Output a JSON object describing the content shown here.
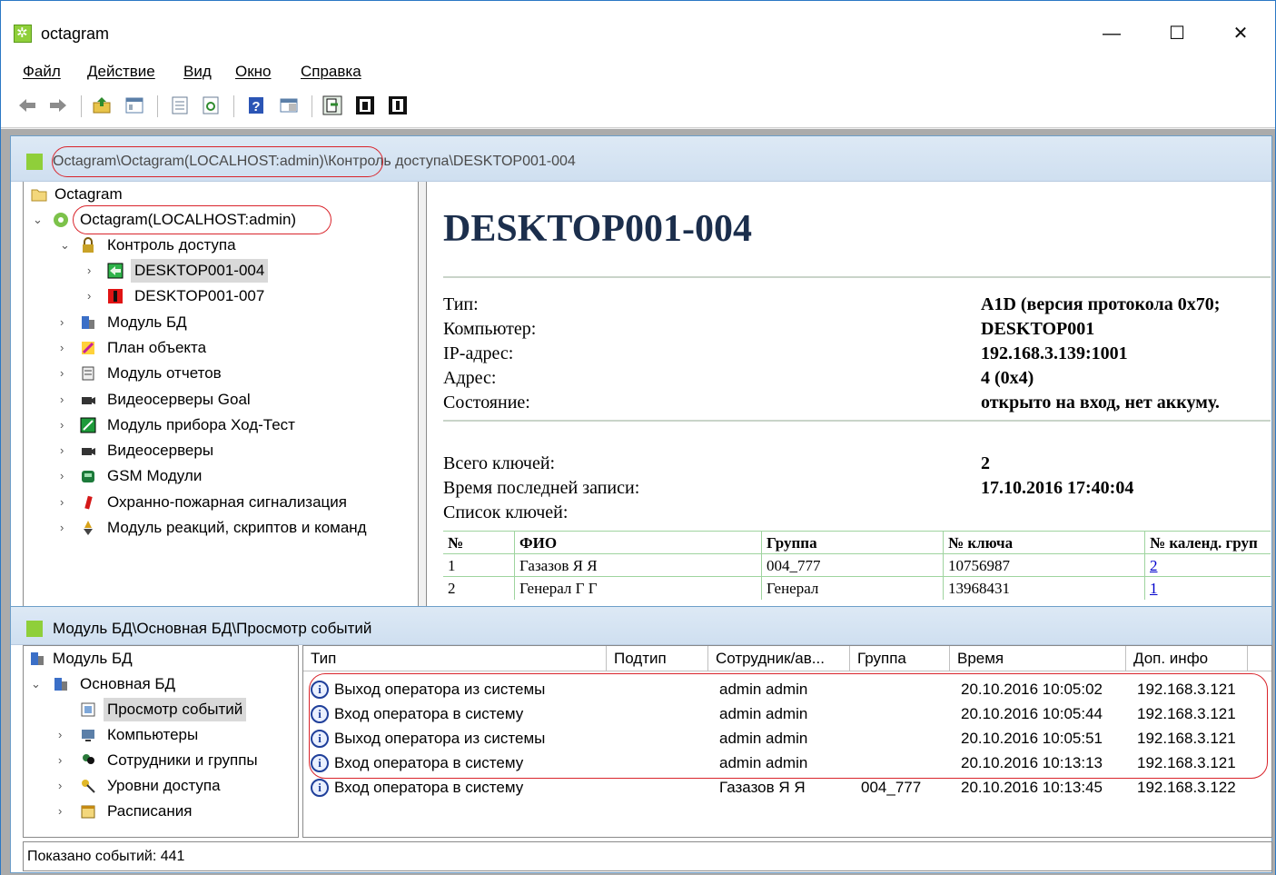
{
  "window": {
    "title": "octagram"
  },
  "menu": [
    "Файл",
    "Действие",
    "Вид",
    "Окно",
    "Справка"
  ],
  "toolbar": [
    "back-icon",
    "forward-icon",
    "folder-up-icon",
    "view-icon",
    "properties-icon",
    "refresh-icon",
    "help-icon",
    "panel-icon",
    "open-door-icon",
    "close-door-icon",
    "lock-door-icon"
  ],
  "top_child": {
    "breadcrumb_part1": "Octagram\\Octagram(LOCALHOST:admin)\\",
    "breadcrumb_part2": "Контроль доступа\\DESKTOP001-004",
    "tree": [
      {
        "label": "Octagram",
        "icon": "folder-icon"
      },
      {
        "label": "Octagram(LOCALHOST:admin)",
        "icon": "server-icon"
      },
      {
        "label": "Контроль доступа",
        "icon": "lock-icon"
      },
      {
        "label": "DESKTOP001-004",
        "icon": "door-open-icon"
      },
      {
        "label": "DESKTOP001-007",
        "icon": "door-closed-icon"
      },
      {
        "label": "Модуль БД",
        "icon": "database-icon"
      },
      {
        "label": "План объекта",
        "icon": "plan-icon"
      },
      {
        "label": "Модуль отчетов",
        "icon": "report-icon"
      },
      {
        "label": "Видеосерверы Goal",
        "icon": "camera-icon"
      },
      {
        "label": "Модуль прибора Ход-Тест",
        "icon": "device-icon"
      },
      {
        "label": "Видеосерверы",
        "icon": "camera-icon"
      },
      {
        "label": "GSM Модули",
        "icon": "phone-icon"
      },
      {
        "label": "Охранно-пожарная сигнализация",
        "icon": "alarm-icon"
      },
      {
        "label": "Модуль реакций, скриптов и команд",
        "icon": "script-icon"
      }
    ],
    "detail": {
      "title": "DESKTOP001-004",
      "fields": [
        {
          "label": "Тип:",
          "value": "A1D (версия протокола 0x70;"
        },
        {
          "label": "Компьютер:",
          "value": "DESKTOP001"
        },
        {
          "label": "IP-адрес:",
          "value": "192.168.3.139:1001"
        },
        {
          "label": "Адрес:",
          "value": "4 (0x4)"
        },
        {
          "label": "Состояние:",
          "value": "открыто на вход, нет аккуму."
        }
      ],
      "fields2": [
        {
          "label": "Всего ключей:",
          "value": "2"
        },
        {
          "label": "Время последней записи:",
          "value": "17.10.2016 17:40:04"
        },
        {
          "label": "Список ключей:",
          "value": ""
        }
      ],
      "keys_columns": [
        "№",
        "ФИО",
        "Группа",
        "№ ключа",
        "№ календ. груп"
      ],
      "keys_rows": [
        [
          "1",
          "Газазов Я Я",
          "004_777",
          "10756987",
          "2"
        ],
        [
          "2",
          "Генерал Г Г",
          "Генерал",
          "13968431",
          "1"
        ]
      ]
    }
  },
  "bottom_child": {
    "caption": "Модуль БД\\Основная БД\\Просмотр событий",
    "tree": [
      {
        "label": "Модуль БД",
        "icon": "database-icon"
      },
      {
        "label": "Основная БД",
        "icon": "database-icon"
      },
      {
        "label": "Просмотр событий",
        "icon": "events-icon"
      },
      {
        "label": "Компьютеры",
        "icon": "computers-icon"
      },
      {
        "label": "Сотрудники и группы",
        "icon": "users-icon"
      },
      {
        "label": "Уровни доступа",
        "icon": "keys-icon"
      },
      {
        "label": "Расписания",
        "icon": "calendar-icon"
      }
    ],
    "columns": [
      "Тип",
      "Подтип",
      "Сотрудник/ав...",
      "Группа",
      "Время",
      "Доп. инфо"
    ],
    "rows": [
      [
        "Выход оператора из системы",
        "",
        "admin admin",
        "",
        "20.10.2016 10:05:02",
        "192.168.3.121"
      ],
      [
        "Вход оператора в систему",
        "",
        "admin admin",
        "",
        "20.10.2016 10:05:44",
        "192.168.3.121"
      ],
      [
        "Выход оператора из системы",
        "",
        "admin admin",
        "",
        "20.10.2016 10:05:51",
        "192.168.3.121"
      ],
      [
        "Вход оператора в систему",
        "",
        "admin admin",
        "",
        "20.10.2016 10:13:13",
        "192.168.3.121"
      ],
      [
        "Вход оператора в систему",
        "",
        "Газазов Я Я",
        "004_777",
        "20.10.2016 10:13:45",
        "192.168.3.122"
      ]
    ],
    "status": "Показано событий: 441"
  }
}
